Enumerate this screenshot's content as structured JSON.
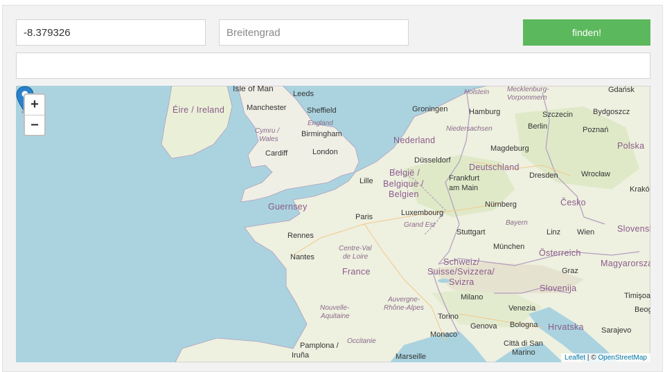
{
  "form": {
    "longitude_value": "-8.379326",
    "latitude_placeholder": "Breitengrad",
    "latitude_value": "",
    "result_value": "",
    "find_label": "finden!"
  },
  "map": {
    "zoom_in": "+",
    "zoom_out": "−",
    "attribution_leaflet": "Leaflet",
    "attribution_sep": " | © ",
    "attribution_osm": "OpenStreetMap",
    "labels": {
      "isle_of_man": "Isle of Man",
      "leeds": "Leeds",
      "eire": "Éire / Ireland",
      "manchester": "Manchester",
      "sheffield": "Sheffield",
      "england": "England",
      "cymru": "Cymru /",
      "wales": "Wales",
      "birmingham": "Birmingham",
      "cardiff": "Cardiff",
      "london": "London",
      "guernsey": "Guernsey",
      "lille": "Lille",
      "paris": "Paris",
      "rennes": "Rennes",
      "nantes": "Nantes",
      "centre_val": "Centre-Val",
      "de_loire": "de Loire",
      "france": "France",
      "nouvelle": "Nouvelle-",
      "aquitaine": "Aquitaine",
      "occitanie": "Occitanie",
      "auvergne": "Auvergne-",
      "rhone_alpes": "Rhône-Alpes",
      "pamplona": "Pamplona /",
      "iruna": "Iruña",
      "marseille": "Marseille",
      "monaco": "Monaco",
      "torino": "Torino",
      "genova": "Genova",
      "milano": "Milano",
      "bologna": "Bologna",
      "venezia": "Venezia",
      "citta_di_san": "Città di San",
      "marino": "Marino",
      "schweiz": "Schweiz/",
      "suisse": "Suisse/Svizzera/",
      "svizra": "Svizra",
      "belgie": "België /",
      "belgique": "Belgique /",
      "belgien": "Belgien",
      "luxembourg": "Luxembourg",
      "grand_est": "Grand Est",
      "nederland": "Nederland",
      "groningen": "Groningen",
      "dusseldorf": "Düsseldorf",
      "holstein": "Holstein",
      "hamburg": "Hamburg",
      "niedersachsen": "Niedersachsen",
      "deutschland": "Deutschland",
      "frankfurt": "Frankfurt",
      "am_main": "am Main",
      "nurnberg": "Nürnberg",
      "stuttgart": "Stuttgart",
      "bayern": "Bayern",
      "munchen": "München",
      "magdeburg": "Magdeburg",
      "berlin": "Berlin",
      "mecklenburg": "Mecklenburg-",
      "vorpommern": "Vorpommern",
      "szczecin": "Szczecin",
      "gdansk": "Gdańsk",
      "bydgoszcz": "Bydgoszcz",
      "poznan": "Poznań",
      "polska": "Polska",
      "dresden": "Dresden",
      "wroclaw": "Wrocław",
      "krakow": "Krakó",
      "cesko": "Česko",
      "linz": "Linz",
      "wien": "Wien",
      "osterreich": "Österreich",
      "graz": "Graz",
      "slovensko": "Slovensk",
      "magyarorszag": "Magyarorsza",
      "slovenija": "Slovenija",
      "hrvatska": "Hrvatska",
      "timisoara": "Timişoa",
      "beog": "Beog",
      "sarajevo": "Sarajevo"
    }
  }
}
